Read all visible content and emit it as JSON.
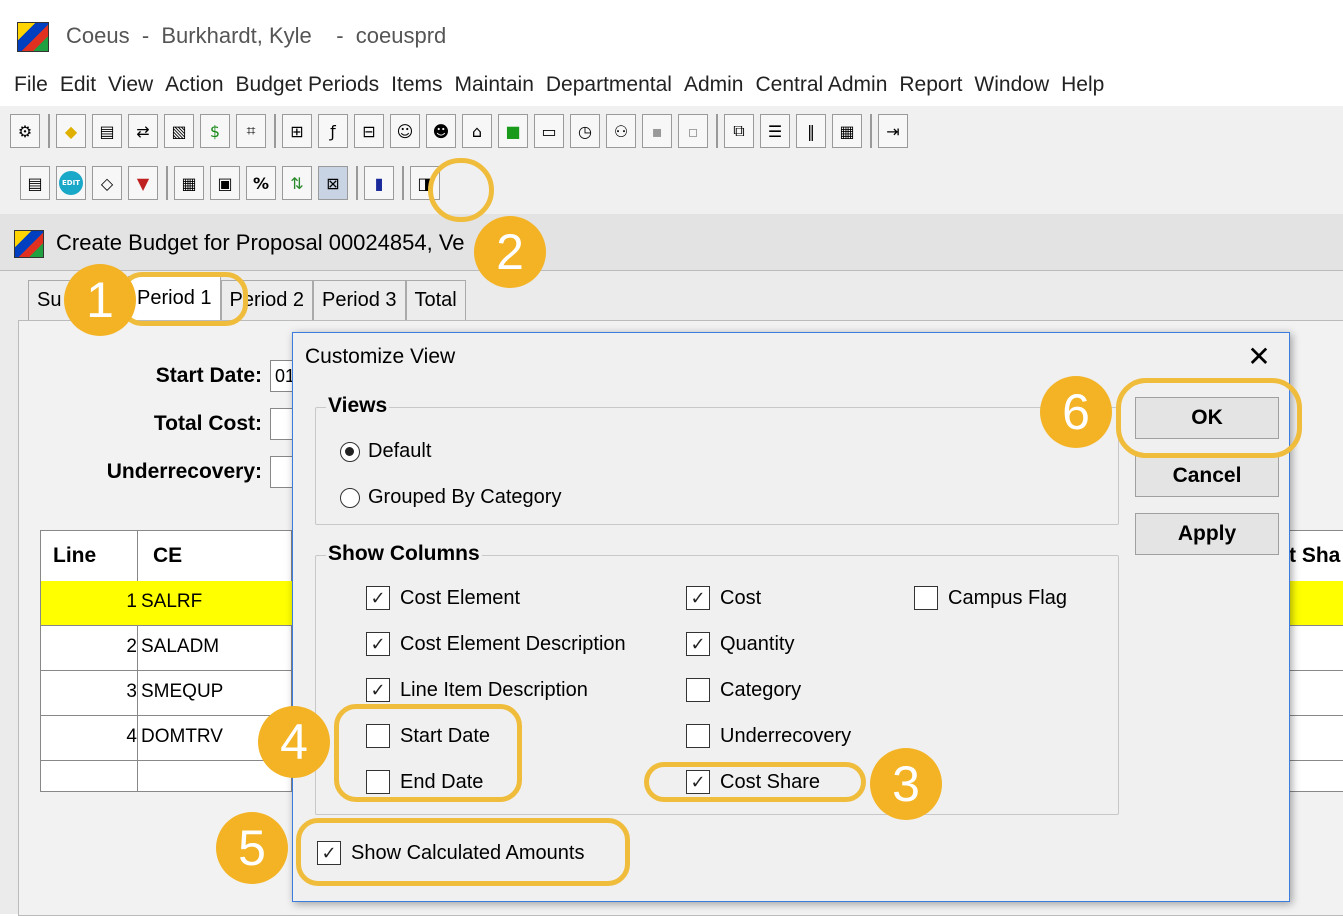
{
  "window": {
    "title": "Coeus  -  Burkhardt, Kyle    -  coeusprd"
  },
  "menu": [
    "File",
    "Edit",
    "View",
    "Action",
    "Budget Periods",
    "Items",
    "Maintain",
    "Departmental",
    "Admin",
    "Central Admin",
    "Report",
    "Window",
    "Help"
  ],
  "toolbar1_icons": [
    "tool-1-icon",
    "diamond-icon",
    "copy-icon",
    "transfer-icon",
    "windows-icon",
    "money-bag-icon",
    "network-icon",
    "tree-icon",
    "formula-icon",
    "hierarchy-icon",
    "people-icon",
    "persons-icon",
    "org-chart-icon",
    "green-square-icon",
    "monitor-icon",
    "clock-icon",
    "group-icon",
    "grey-box-icon",
    "grey-monitor-icon",
    "split-icon",
    "rows-icon",
    "columns-icon",
    "calendar-icon",
    "exit-icon"
  ],
  "toolbar2_icons": [
    "document-icon",
    "edit-icon",
    "eraser-icon",
    "shield-icon",
    "calculator-icon",
    "period-icon",
    "percent-icon",
    "chart-icon",
    "customize-view-icon",
    "save-icon",
    "clipboard-icon"
  ],
  "toolbar2_glyphs": {
    "percent": "%",
    "edit": "EDIT"
  },
  "inner": {
    "title": "Create Budget for Proposal 00024854, Ve"
  },
  "tabs": [
    "Su",
    "Period 1",
    "Period 2",
    "Period 3",
    "Total"
  ],
  "form": {
    "start_date_label": "Start Date:",
    "start_date_value": "01",
    "total_cost_label": "Total Cost:",
    "underrecovery_label": "Underrecovery:"
  },
  "grid": {
    "headers": {
      "line": "Line",
      "ce": "CE",
      "cost_share": "t Sha"
    },
    "rows": [
      {
        "line": "1",
        "ce": "SALRF"
      },
      {
        "line": "2",
        "ce": "SALADM"
      },
      {
        "line": "3",
        "ce": "SMEQUP"
      },
      {
        "line": "4",
        "ce": "DOMTRV"
      }
    ]
  },
  "dialog": {
    "title": "Customize View",
    "close": "✕",
    "views_title": "Views",
    "views": [
      {
        "label": "Default",
        "selected": true
      },
      {
        "label": "Grouped By Category",
        "selected": false
      }
    ],
    "columns_title": "Show Columns",
    "columns": {
      "cost_element": {
        "label": "Cost Element",
        "checked": true
      },
      "cost_element_description": {
        "label": "Cost Element Description",
        "checked": true
      },
      "line_item_description": {
        "label": "Line Item Description",
        "checked": true
      },
      "start_date": {
        "label": "Start Date",
        "checked": false
      },
      "end_date": {
        "label": "End Date",
        "checked": false
      },
      "cost": {
        "label": "Cost",
        "checked": true
      },
      "quantity": {
        "label": "Quantity",
        "checked": true
      },
      "category": {
        "label": "Category",
        "checked": false
      },
      "underrecovery": {
        "label": "Underrecovery",
        "checked": false
      },
      "cost_share": {
        "label": "Cost Share",
        "checked": true
      },
      "campus_flag": {
        "label": "Campus Flag",
        "checked": false
      }
    },
    "show_calculated": {
      "label": "Show Calculated Amounts",
      "checked": true
    },
    "buttons": {
      "ok": "OK",
      "cancel": "Cancel",
      "apply": "Apply"
    }
  },
  "callouts": [
    "1",
    "2",
    "3",
    "4",
    "5",
    "6"
  ],
  "colors": {
    "callout": "#f3b324",
    "selected_row": "#ffff00",
    "dialog_border": "#3b7ddd"
  }
}
